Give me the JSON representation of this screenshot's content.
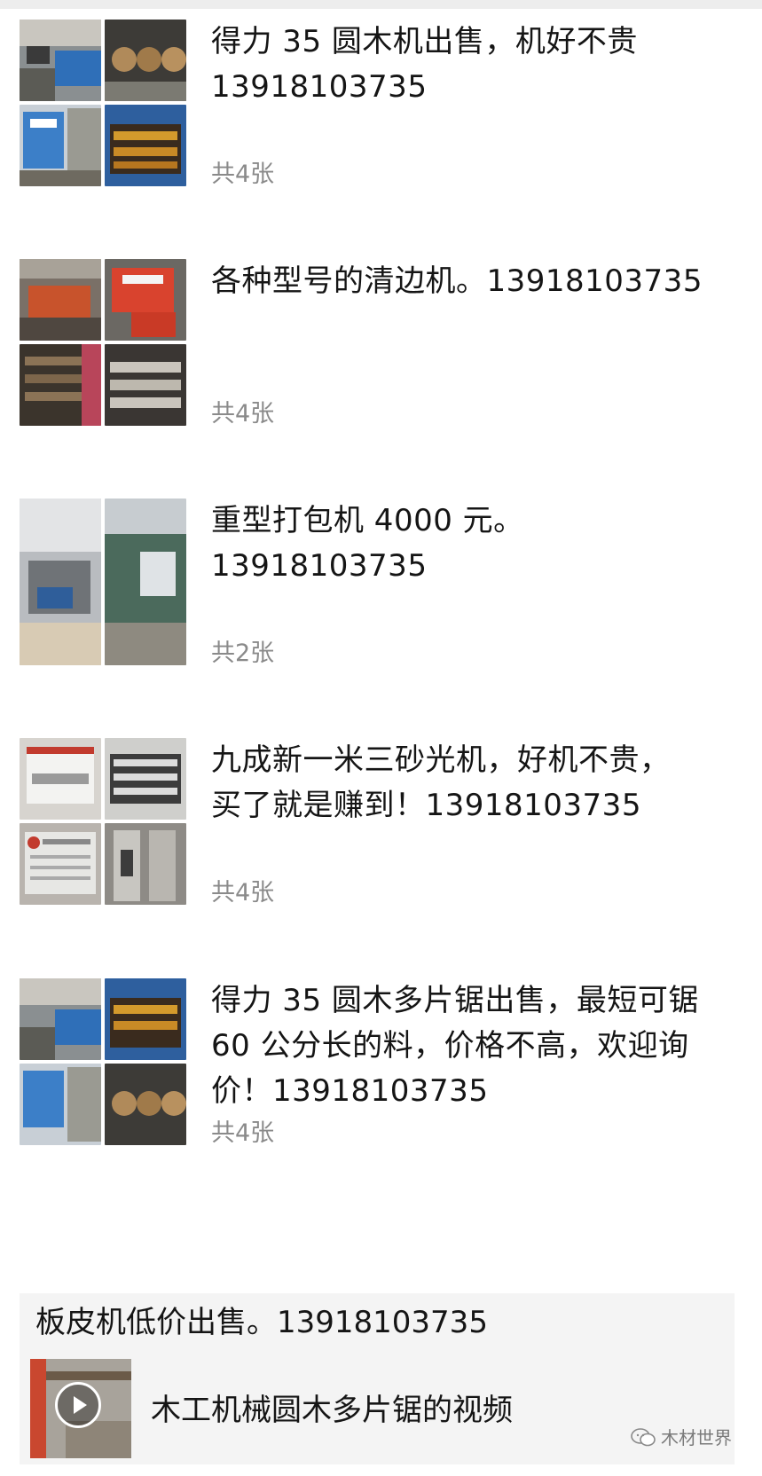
{
  "posts": [
    {
      "text": "得力 35 圆木机出售，机好不贵\n13918103735",
      "count": "共4张",
      "thumbs": [
        "machine-photo",
        "machine-photo",
        "machine-photo",
        "machine-photo"
      ]
    },
    {
      "text": "各种型号的清边机。13918103735",
      "count": "共4张",
      "thumbs": [
        "machine-photo",
        "machine-photo",
        "machine-photo",
        "machine-photo"
      ]
    },
    {
      "text": "重型打包机 4000 元。\n13918103735",
      "count": "共2张",
      "thumbs": [
        "machine-photo",
        "machine-photo"
      ]
    },
    {
      "text": "九成新一米三砂光机，好机不贵，\n买了就是赚到！13918103735",
      "count": "共4张",
      "thumbs": [
        "machine-photo",
        "machine-photo",
        "machine-photo",
        "machine-photo"
      ]
    },
    {
      "text": "得力 35 圆木多片锯出售，最短可锯\n60 公分长的料，价格不高，欢迎询\n价！13918103735",
      "count": "共4张",
      "thumbs": [
        "machine-photo",
        "machine-photo",
        "machine-photo",
        "machine-photo"
      ]
    }
  ],
  "share": {
    "text": "板皮机低价出售。13918103735",
    "video_title": "木工机械圆木多片锯的视频",
    "video_icon": "play-icon"
  },
  "watermark": {
    "label": "木材世界",
    "icon": "wechat-icon"
  },
  "colors": {
    "text": "#151515",
    "muted": "#8a8a8a",
    "card_bg": "#f4f4f4",
    "topbar": "#ededed"
  }
}
